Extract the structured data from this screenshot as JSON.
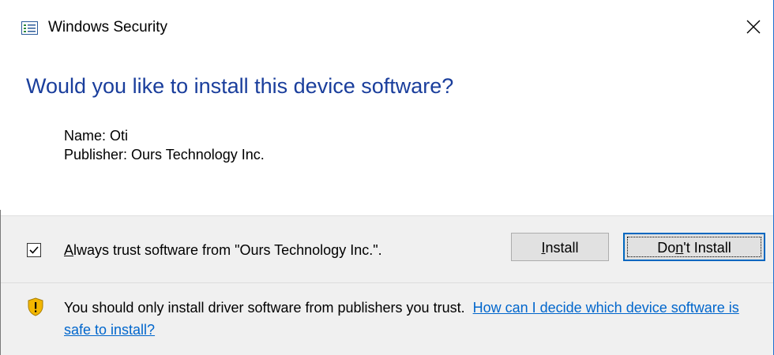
{
  "window": {
    "title": "Windows Security",
    "icon": "security-center-icon",
    "close_icon": "close-icon"
  },
  "heading": "Would you like to install this device software?",
  "details": {
    "name": "Name: Oti",
    "publisher": "Publisher: Ours Technology Inc."
  },
  "trust": {
    "checked": true,
    "label_accel": "A",
    "label_rest": "lways trust software from \"Ours Technology Inc.\"."
  },
  "buttons": {
    "install_accel": "I",
    "install_rest": "nstall",
    "dont_pre": "Do",
    "dont_accel": "n",
    "dont_post": "'t Install"
  },
  "warning": {
    "icon": "shield-warning-icon",
    "text": "You should only install driver software from publishers you trust.",
    "link": "How can I decide which device software is safe to install?"
  },
  "colors": {
    "heading": "#1a3e9c",
    "link": "#0066cc",
    "panel": "#f0f0f0",
    "default_button_border": "#0067c0"
  }
}
